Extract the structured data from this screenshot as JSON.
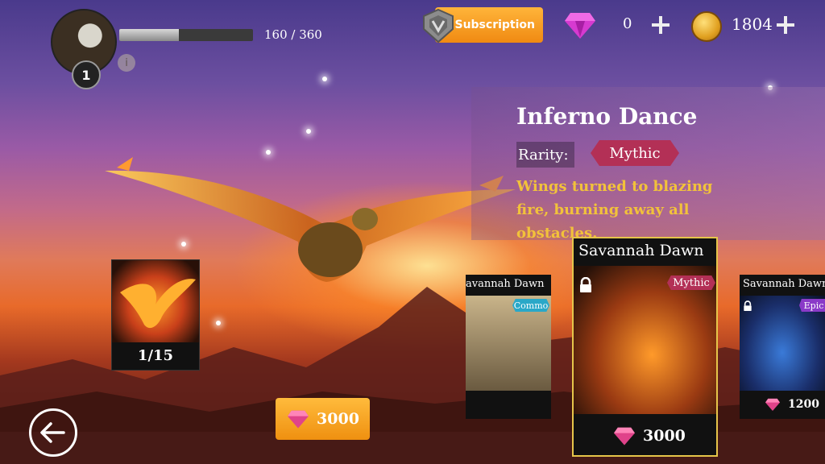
{
  "player": {
    "level": "1",
    "xp_text": "160 / 360",
    "xp_fraction": 0.444
  },
  "hud": {
    "subscription_label": "Subscription",
    "gems": "0",
    "coins": "1804"
  },
  "skin": {
    "title": "Inferno Dance",
    "rarity_label": "Rarity:",
    "rarity": "Mythic",
    "description": "Wings turned to blazing fire, burning away all obstacles.",
    "owned_count": "1/15",
    "buy_price": "3000"
  },
  "cards": [
    {
      "name": "avannah Dawn",
      "rarity": "Commo",
      "locked": false,
      "price": ""
    },
    {
      "name": "Savannah Dawn",
      "rarity": "Mythic",
      "locked": true,
      "price": "3000"
    },
    {
      "name": "Savannah Dawn",
      "rarity": "Epic",
      "locked": true,
      "price": "1200"
    }
  ],
  "colors": {
    "mythic": "#b33056",
    "common": "#2aa8c8",
    "epic": "#8a3ac8",
    "gold": "#f2c23a",
    "orange": "#f29a18"
  },
  "icons": [
    "shield-icon",
    "gem-icon",
    "plus-icon",
    "coin-icon",
    "lock-icon",
    "back-arrow-icon"
  ]
}
